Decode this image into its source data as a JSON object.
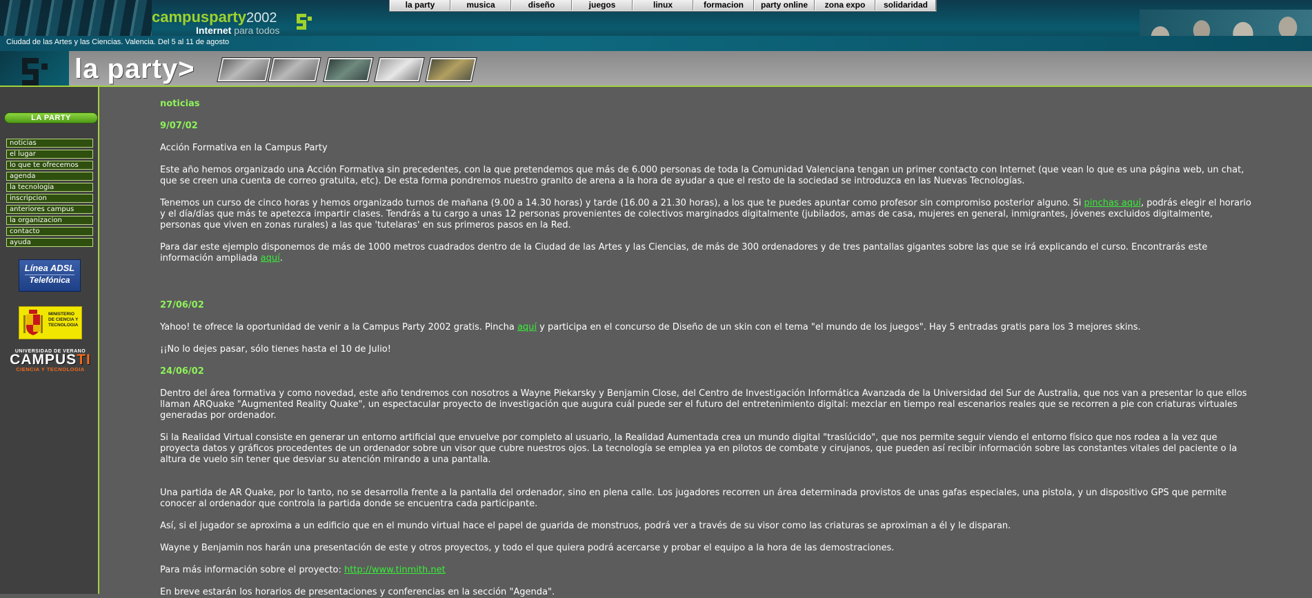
{
  "header": {
    "brand_name": "campusparty",
    "brand_year": "2002",
    "slogan_strong": "Internet",
    "slogan_light": "para todos",
    "location": "Ciudad de las Artes y las Ciencias. Valencia. Del 5 al 11 de agosto",
    "brand_color": "#9fd22c"
  },
  "top_nav": {
    "items": [
      {
        "label": "la party"
      },
      {
        "label": "musica"
      },
      {
        "label": "diseño"
      },
      {
        "label": "juegos"
      },
      {
        "label": "linux"
      },
      {
        "label": "formacion"
      },
      {
        "label": "party online"
      },
      {
        "label": "zona expo"
      },
      {
        "label": "solidaridad"
      }
    ]
  },
  "section": {
    "title": "la party>"
  },
  "sidebar": {
    "title": "LA PARTY",
    "items": [
      {
        "label": "noticias"
      },
      {
        "label": "el lugar"
      },
      {
        "label": "lo que te ofrecemos"
      },
      {
        "label": "agenda"
      },
      {
        "label": "la tecnologia"
      },
      {
        "label": "inscripcion"
      },
      {
        "label": "anteriores campus"
      },
      {
        "label": "la organizacion"
      },
      {
        "label": "contacto"
      },
      {
        "label": "ayuda"
      }
    ],
    "sponsors": {
      "adsl_line1": "Línea ADSL",
      "adsl_line2": "Telefónica",
      "ministerio_text": "MINISTERIO DE CIENCIA Y TECNOLOGIA",
      "campus_line1": "UNIVERSIDAD DE VERANO",
      "campus_main": "CAMPUS",
      "campus_ti": "TI",
      "campus_line3": "CIENCIA Y TECNOLOGIA"
    }
  },
  "content": {
    "heading": "noticias",
    "news": [
      {
        "date": "9/07/02",
        "title": "Acción Formativa en la Campus Party",
        "p1": "Este año hemos organizado una Acción Formativa sin precedentes, con la que pretendemos que más de 6.000 personas de toda la Comunidad Valenciana tengan un primer contacto con Internet (que vean lo que es una página web, un chat, que se creen una cuenta de correo gratuita, etc). De esta forma pondremos nuestro granito de arena a la hora de ayudar a que el resto de la sociedad se introduzca en las Nuevas Tecnologías.",
        "p2_before": "Tenemos un curso de cinco horas y hemos organizado turnos de mañana (9.00 a 14.30 horas) y tarde (16.00 a 21.30 horas), a los que te puedes apuntar como profesor sin compromiso posterior alguno. Si ",
        "p2_link": "pinchas aquí",
        "p2_after": ", podrás elegir el horario y el día/días que más te apetezca impartir clases. Tendrás a tu cargo a unas 12 personas provenientes de colectivos marginados digitalmente (jubilados, amas de casa, mujeres en general, inmigrantes, jóvenes excluidos digitalmente, personas que viven en zonas rurales) a las que 'tutelaras' en sus primeros pasos en la Red.",
        "p3_before": "Para dar este ejemplo disponemos de más de 1000 metros cuadrados dentro de la Ciudad de las Artes y las Ciencias, de más de 300 ordenadores y de tres pantallas gigantes sobre las que se irá explicando el curso. Encontrarás este información ampliada ",
        "p3_link": "aquí",
        "p3_after": "."
      },
      {
        "date": "27/06/02",
        "p1_before": "Yahoo! te ofrece la oportunidad de venir a la Campus Party 2002 gratis. Pincha ",
        "p1_link": "aquí",
        "p1_after": " y participa en el concurso de Diseño de un skin con el tema \"el mundo de los juegos\". Hay 5 entradas gratis para los 3 mejores skins.",
        "p2": "¡¡No lo dejes pasar, sólo tienes hasta el 10 de Julio!"
      },
      {
        "date": "24/06/02",
        "p1": "Dentro del área formativa y como novedad, este año tendremos con nosotros a Wayne Piekarsky y Benjamin Close, del Centro de Investigación Informática Avanzada de la Universidad del Sur de Australia, que nos van a presentar lo que ellos llaman ARQuake \"Augmented Reality Quake\", un espectacular proyecto de investigación que augura cuál puede ser el futuro del entretenimiento digital: mezclar en tiempo real escenarios reales que se recorren a pie con criaturas virtuales generadas por ordenador.",
        "p2": "Si la Realidad Virtual consiste en generar un entorno artificial que envuelve por completo al usuario, la Realidad Aumentada crea un mundo digital \"traslúcido\", que nos permite seguir viendo el entorno físico que nos rodea a la vez que proyecta datos y gráficos procedentes de un ordenador sobre un visor que cubre nuestros ojos. La tecnología se emplea ya en pilotos de combate y cirujanos, que pueden así recibir información sobre las constantes vitales del paciente o la altura de vuelo sin tener que desviar su atención mirando a una pantalla.",
        "p3": "Una partida de AR Quake, por lo tanto, no se desarrolla frente a la pantalla del ordenador, sino en plena calle. Los jugadores recorren un área determinada provistos de unas gafas especiales, una pistola, y un dispositivo GPS que permite conocer al ordenador que controla la partida donde se encuentra cada participante.",
        "p4": "Así, si el jugador se aproxima a un edificio que en el mundo virtual hace el papel de guarida de monstruos, podrá ver a través de su visor como las criaturas se aproximan a él y le disparan.",
        "p5": "Wayne y Benjamin nos harán una presentación de este y otros proyectos, y todo el que quiera podrá acercarse y probar el equipo a la hora de las demostraciones.",
        "p6_before": "Para más información sobre el proyecto: ",
        "p6_link": "http://www.tinmith.net",
        "p7": "En breve estarán los horarios de presentaciones y conferencias en la sección \"Agenda\"."
      }
    ],
    "link_color": "#38ee38",
    "heading_color": "#8ef25a"
  }
}
